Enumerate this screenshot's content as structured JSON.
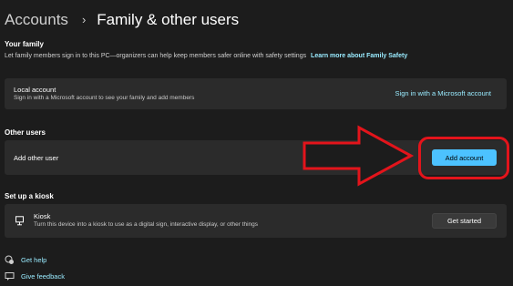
{
  "breadcrumb": {
    "parent": "Accounts",
    "separator": "›",
    "current": "Family & other users"
  },
  "your_family": {
    "title": "Your family",
    "description": "Let family members sign in to this PC—organizers can help keep members safer online with safety settings",
    "learn_more_link": "Learn more about Family Safety",
    "local_account": {
      "title": "Local account",
      "subtitle": "Sign in with a Microsoft account to see your family and add members",
      "action": "Sign in with a Microsoft account"
    }
  },
  "other_users": {
    "title": "Other users",
    "add_other_user": {
      "label": "Add other user",
      "button": "Add account"
    }
  },
  "kiosk": {
    "title": "Set up a kiosk",
    "card_title": "Kiosk",
    "card_subtitle": "Turn this device into a kiosk to use as a digital sign, interactive display, or other things",
    "button": "Get started"
  },
  "footer": {
    "get_help": "Get help",
    "give_feedback": "Give feedback"
  },
  "colors": {
    "background": "#1c1c1c",
    "card": "#2b2b2b",
    "accent": "#4cc2ff",
    "link": "#99ebff",
    "annotation_red": "#e3141b"
  }
}
